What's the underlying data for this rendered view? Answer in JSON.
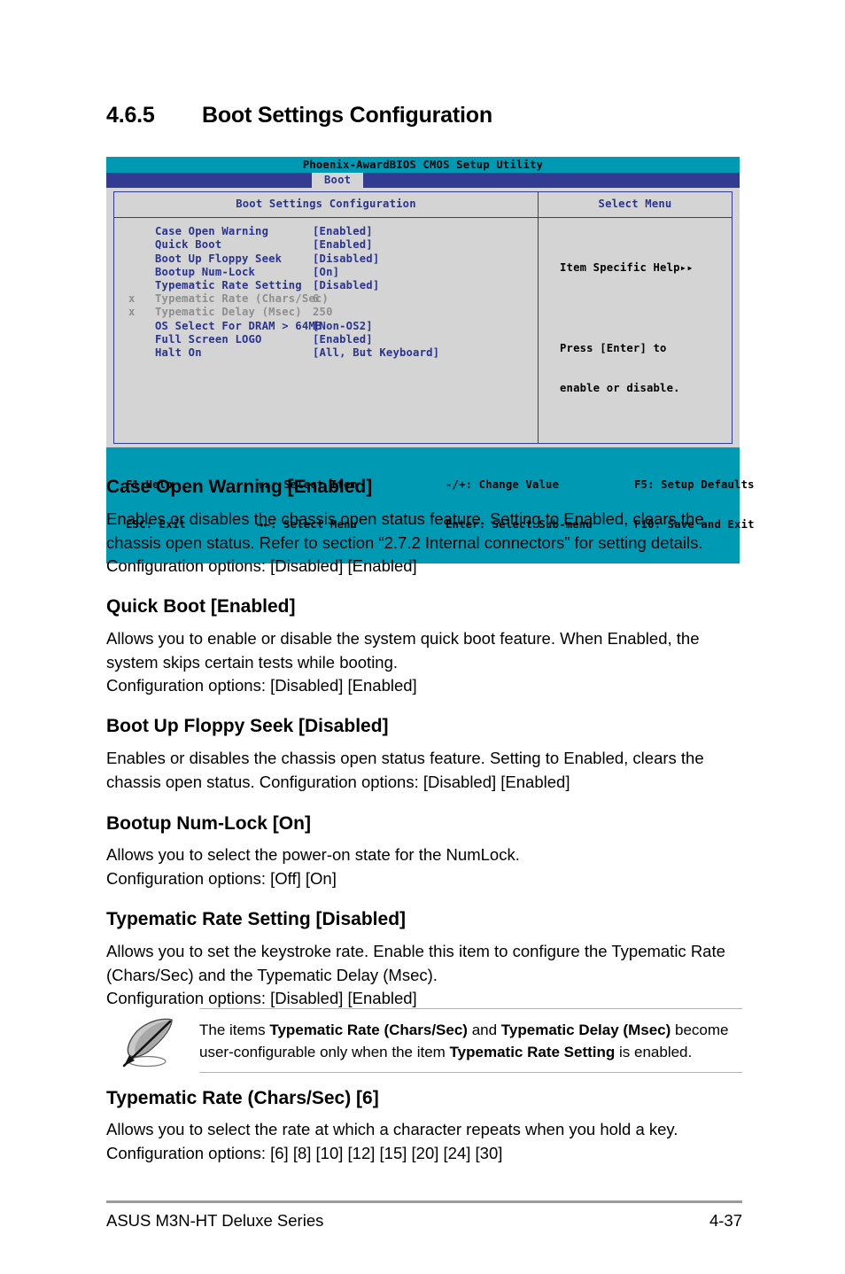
{
  "section": {
    "number": "4.6.5",
    "title": "Boot Settings Configuration"
  },
  "bios": {
    "title": "Phoenix-AwardBIOS CMOS Setup Utility",
    "tab": "Boot",
    "left_panel_title": "Boot Settings Configuration",
    "right_panel_title": "Select Menu",
    "options": [
      {
        "mark": "",
        "name": "Case Open Warning",
        "value": "[Enabled]",
        "dim": false
      },
      {
        "mark": "",
        "name": "Quick Boot",
        "value": "[Enabled]",
        "dim": false
      },
      {
        "mark": "",
        "name": "Boot Up Floppy Seek",
        "value": "[Disabled]",
        "dim": false
      },
      {
        "mark": "",
        "name": "Bootup Num-Lock",
        "value": "[On]",
        "dim": false
      },
      {
        "mark": "",
        "name": "Typematic Rate Setting",
        "value": "[Disabled]",
        "dim": false
      },
      {
        "mark": "x",
        "name": "Typematic Rate (Chars/Sec)",
        "value": "6",
        "dim": true
      },
      {
        "mark": "x",
        "name": "Typematic Delay (Msec)",
        "value": "250",
        "dim": true
      },
      {
        "mark": "",
        "name": "OS Select For DRAM > 64MB",
        "value": "[Non-OS2]",
        "dim": false
      },
      {
        "mark": "",
        "name": "Full Screen LOGO",
        "value": "[Enabled]",
        "dim": false
      },
      {
        "mark": "",
        "name": "Halt On",
        "value": "[All, But Keyboard]",
        "dim": false
      }
    ],
    "help": {
      "title": "Item Specific Help▸▸",
      "line1": "Press [Enter] to",
      "line2": "enable or disable."
    },
    "footer": {
      "row1_a": "F1:Help",
      "row1_b": "↑↓: Select Item",
      "row1_c": "-/+: Change Value",
      "row1_d": "F5: Setup Defaults",
      "row2_a": "ESC: Exit",
      "row2_b": "→←: Select Menu",
      "row2_c": "Enter: Select Sub-menu",
      "row2_d": "F10: Save and Exit"
    },
    "colors": {
      "titlebar": "#0099b4",
      "menubar": "#333a91",
      "panel_bg": "#d4d4d4",
      "text_blue": "#2a3490",
      "text_dim": "#8e8e8e"
    }
  },
  "items": [
    {
      "heading": "Case Open Warning [Enabled]",
      "body": "Enables or disables the chassis open status feature. Setting to Enabled, clears the chassis open status. Refer to section “2.7.2 Internal connectors” for setting details. Configuration options: [Disabled] [Enabled]"
    },
    {
      "heading": "Quick Boot [Enabled]",
      "body": "Allows you to enable or disable the system quick boot feature. When Enabled, the system skips certain tests while booting.\nConfiguration options: [Disabled] [Enabled]"
    },
    {
      "heading": "Boot Up Floppy Seek [Disabled]",
      "body": "Enables or disables the chassis open status feature. Setting to Enabled, clears the chassis open status. Configuration options: [Disabled] [Enabled]"
    },
    {
      "heading": "Bootup Num-Lock [On]",
      "body": "Allows you to select the power-on state for the NumLock.\nConfiguration options: [Off] [On]"
    },
    {
      "heading": "Typematic Rate Setting [Disabled]",
      "body": "Allows you to set the keystroke rate. Enable this item to configure the Typematic Rate (Chars/Sec) and the Typematic Delay (Msec).\nConfiguration options: [Disabled] [Enabled]"
    },
    {
      "heading": "Typematic Rate (Chars/Sec) [6]",
      "body": "Allows you to select the rate at which a character repeats when you hold a key.\nConfiguration options: [6] [8] [10] [12] [15] [20] [24] [30]"
    }
  ],
  "note": {
    "t1": "The items ",
    "b1": "Typematic Rate (Chars/Sec)",
    "t2": " and ",
    "b2": "Typematic Delay (Msec)",
    "t3": " become user-configurable only when the item ",
    "b3": "Typematic Rate Setting",
    "t4": " is enabled."
  },
  "page_footer": {
    "left": "ASUS M3N-HT Deluxe Series",
    "right": "4-37"
  }
}
